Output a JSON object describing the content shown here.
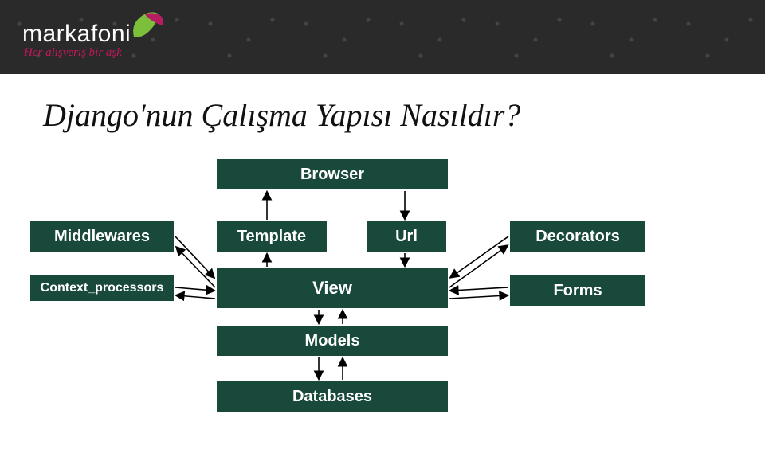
{
  "brand": {
    "name": "markafoni",
    "tagline": "Her alışveriş bir aşk"
  },
  "slide": {
    "title": "Django'nun Çalışma Yapısı Nasıldır?"
  },
  "boxes": {
    "browser": "Browser",
    "middlewares": "Middlewares",
    "context_processors": "Context_processors",
    "template": "Template",
    "url": "Url",
    "view": "View",
    "models": "Models",
    "databases": "Databases",
    "decorators": "Decorators",
    "forms": "Forms"
  }
}
